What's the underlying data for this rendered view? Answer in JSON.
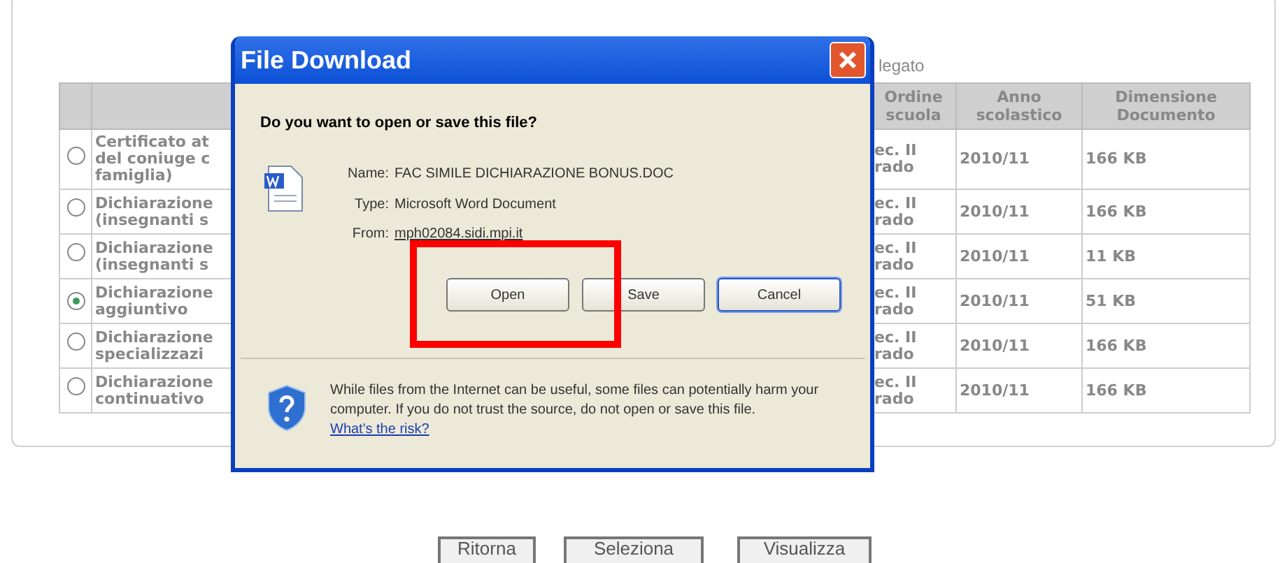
{
  "page": {
    "caption_fragment": "legato",
    "table": {
      "columns": [
        {
          "label": "Ordine\nscuola"
        },
        {
          "label": "Anno\nscolastico"
        },
        {
          "label": "Dimensione\nDocumento"
        }
      ],
      "rows": [
        {
          "selected": false,
          "description": "Certificato at\ndel coniuge c\nfamiglia)",
          "cells": [
            "ec. II\nrado",
            "2010/11",
            "166 KB"
          ]
        },
        {
          "selected": false,
          "description": "Dichiarazione\n(insegnanti s",
          "cells": [
            "ec. II\nrado",
            "2010/11",
            "166 KB"
          ]
        },
        {
          "selected": false,
          "description": "Dichiarazione\n(insegnanti s",
          "cells": [
            "ec. II\nrado",
            "2010/11",
            "11 KB"
          ]
        },
        {
          "selected": true,
          "description": "Dichiarazione\naggiuntivo",
          "cells": [
            "ec. II\nrado",
            "2010/11",
            "51 KB"
          ]
        },
        {
          "selected": false,
          "description": "Dichiarazione\nspecializzazi",
          "cells": [
            "ec. II\nrado",
            "2010/11",
            "166 KB"
          ]
        },
        {
          "selected": false,
          "description": "Dichiarazione\ncontinuativo",
          "cells": [
            "ec. II\nrado",
            "2010/11",
            "166 KB"
          ]
        }
      ]
    },
    "buttons": [
      "Ritorna",
      "Seleziona",
      "Visualizza"
    ]
  },
  "dialog": {
    "title": "File Download",
    "question": "Do you want to open or save this file?",
    "fields": [
      {
        "label": "Name:",
        "value": "FAC SIMILE DICHIARAZIONE BONUS.DOC"
      },
      {
        "label": "Type:",
        "value": "Microsoft Word Document"
      },
      {
        "label": "From:",
        "value": "mph02084.sidi.mpi.it"
      }
    ],
    "buttons": [
      {
        "label": "Open",
        "focused": false
      },
      {
        "label": "Save",
        "focused": false
      },
      {
        "label": "Cancel",
        "focused": true
      }
    ],
    "warning": "While files from the Internet can be useful, some files can potentially harm your computer. If you do not trust the source, do not open or save this file.",
    "link": "What's the risk?"
  }
}
